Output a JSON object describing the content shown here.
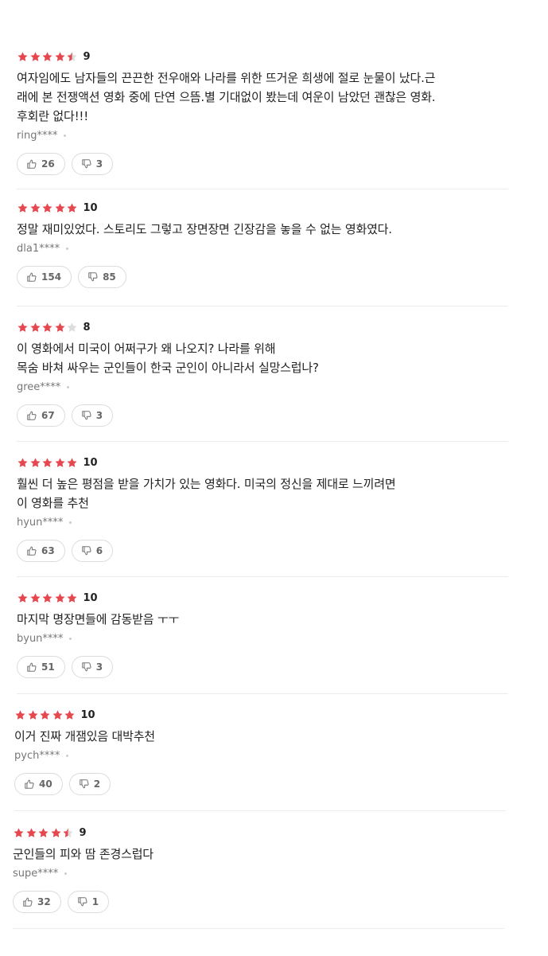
{
  "colors": {
    "star_filled": "#e6484f",
    "star_empty": "#dddddd"
  },
  "reviews": [
    {
      "stars": 4.5,
      "score": "9",
      "text": "여자임에도 남자들의 끈끈한 전우애와 나라를 위한 뜨거운 희생에 절로 눈물이 났다.근\n래에 본 전쟁액션 영화 중에 단연 으뜸.별 기대없이 봤는데 여운이 남았던 괜찮은 영화.\n후회란 없다!!!",
      "author": "ring****",
      "likes": "26",
      "dislikes": "3"
    },
    {
      "stars": 5,
      "score": "10",
      "text": "정말 재미있었다. 스토리도 그렇고 장면장면 긴장감을 놓을 수 없는 영화였다.",
      "author": "dla1****",
      "likes": "154",
      "dislikes": "85"
    },
    {
      "stars": 4,
      "score": "8",
      "text": "이 영화에서 미국이 어쩌구가 왜 나오지? 나라를 위해\n목숨 바쳐 싸우는 군인들이 한국 군인이 아니라서 실망스럽나?",
      "author": "gree****",
      "likes": "67",
      "dislikes": "3"
    },
    {
      "stars": 5,
      "score": "10",
      "text": "훨씬 더 높은 평점을 받을 가치가 있는 영화다. 미국의 정신을 제대로 느끼려면\n이 영화를 추천",
      "author": "hyun****",
      "likes": "63",
      "dislikes": "6"
    },
    {
      "stars": 5,
      "score": "10",
      "text": "마지막 명장면들에 감동받음 ㅜㅜ",
      "author": "byun****",
      "likes": "51",
      "dislikes": "3"
    },
    {
      "stars": 5,
      "score": "10",
      "text": "이거 진짜 개잼있음 대박추천",
      "author": "pych****",
      "likes": "40",
      "dislikes": "2"
    },
    {
      "stars": 4.5,
      "score": "9",
      "text": "군인들의 피와 땀 존경스럽다",
      "author": "supe****",
      "likes": "32",
      "dislikes": "1"
    }
  ]
}
